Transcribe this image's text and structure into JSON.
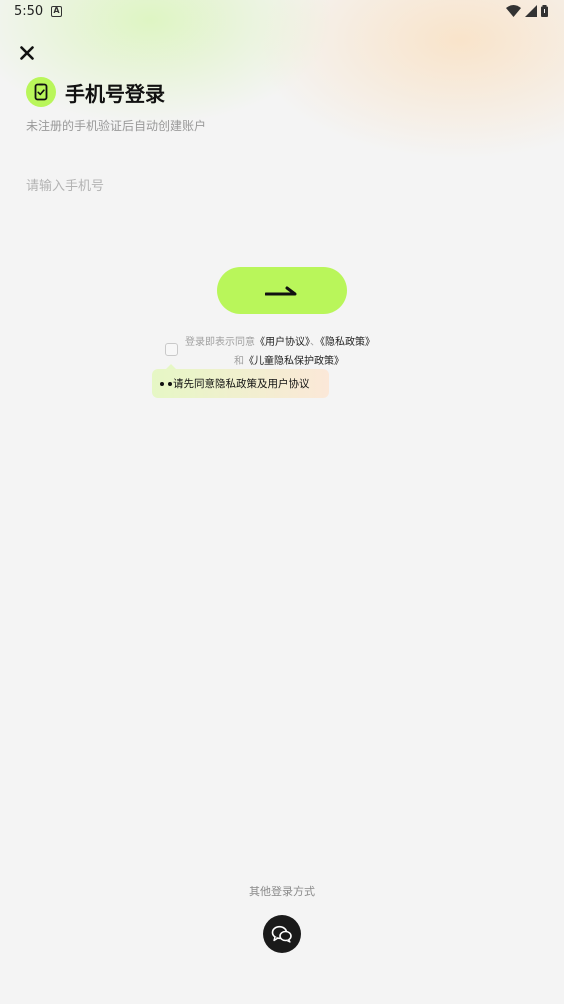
{
  "status_bar": {
    "time": "5:50",
    "notification_icon": "a-icon"
  },
  "header": {
    "title": "手机号登录",
    "subtitle": "未注册的手机验证后自动创建账户"
  },
  "phone": {
    "placeholder": "请输入手机号",
    "value": ""
  },
  "agreement": {
    "checked": false,
    "prefix": "登录即表示同意",
    "user_agreement": "《用户协议》",
    "separator": "、",
    "privacy_policy": "《隐私政策》",
    "and": "和",
    "child_privacy": "《儿童隐私保护政策》"
  },
  "tooltip": {
    "text": "请先同意隐私政策及用户协议"
  },
  "other_login": {
    "label": "其他登录方式",
    "methods": [
      "wechat-icon"
    ]
  },
  "colors": {
    "accent": "#b9f65a",
    "background": "#f4f4f4",
    "dark": "#1a1a1a"
  }
}
